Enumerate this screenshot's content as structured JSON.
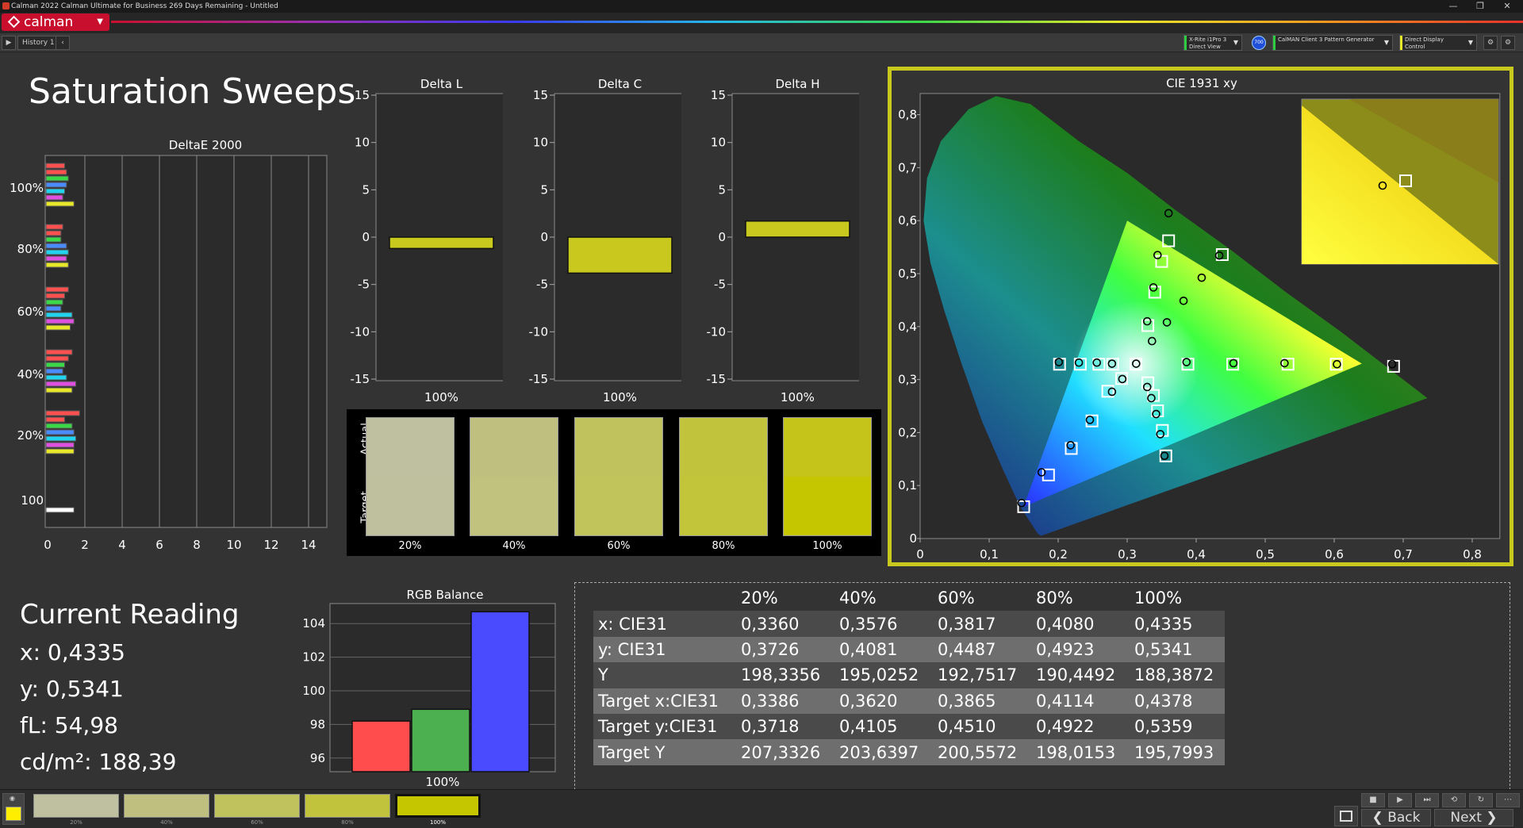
{
  "window": {
    "title": "Calman 2022 Calman Ultimate for Business 269 Days Remaining  - Untitled",
    "logo": "calman",
    "minimize": "—",
    "restore": "❐",
    "close": "✕"
  },
  "toolbar": {
    "history_tab": "History 1",
    "devices": [
      {
        "line1": "X-Rite i1Pro 3",
        "line2": "Direct View",
        "accent": "#2ecc40"
      },
      {
        "line1": "CalMAN Client 3 Pattern Generator",
        "line2": "",
        "accent": "#2ecc40"
      },
      {
        "line1": "Direct Display Control",
        "line2": "",
        "accent": "#e8e82a"
      }
    ],
    "badge": "700"
  },
  "page": {
    "title": "Saturation Sweeps"
  },
  "deltae_chart": {
    "title": "DeltaE 2000",
    "x_ticks": [
      "0",
      "2",
      "4",
      "6",
      "8",
      "10",
      "12",
      "14"
    ],
    "y_labels": [
      "100%",
      "80%",
      "60%",
      "40%",
      "20%",
      "100"
    ],
    "xlim": [
      0,
      15
    ],
    "groups": [
      {
        "label": "100%",
        "values": [
          1.0,
          1.1,
          1.2,
          1.1,
          1.0,
          0.9,
          1.5
        ]
      },
      {
        "label": "80%",
        "values": [
          0.9,
          0.8,
          0.8,
          1.1,
          1.2,
          1.1,
          1.2
        ]
      },
      {
        "label": "60%",
        "values": [
          1.2,
          1.0,
          0.9,
          0.8,
          1.4,
          1.5,
          1.3
        ]
      },
      {
        "label": "40%",
        "values": [
          1.4,
          1.2,
          1.0,
          0.9,
          1.1,
          1.6,
          1.4
        ]
      },
      {
        "label": "20%",
        "values": [
          1.8,
          1.0,
          1.4,
          1.5,
          1.6,
          1.5,
          1.5
        ]
      },
      {
        "label": "100",
        "values": [
          1.5
        ]
      }
    ],
    "series_colors": [
      "#ff5050",
      "#ff5050",
      "#3bd84a",
      "#4a8cff",
      "#22d3ee",
      "#e050e0",
      "#e8e82a"
    ]
  },
  "delta_charts": [
    {
      "title": "Delta L",
      "category": "100%",
      "value": -1.2
    },
    {
      "title": "Delta C",
      "category": "100%",
      "value": -3.8
    },
    {
      "title": "Delta H",
      "category": "100%",
      "value": 1.7
    }
  ],
  "delta_ticks": [
    "15",
    "10",
    "5",
    "0",
    "-5",
    "-10",
    "-15"
  ],
  "swatches": {
    "actual_label": "Actual",
    "target_label": "Target",
    "items": [
      {
        "label": "20%",
        "actual": "#bfc0a0",
        "target": "#bfc19e"
      },
      {
        "label": "40%",
        "actual": "#bfc07f",
        "target": "#c0c27d"
      },
      {
        "label": "60%",
        "actual": "#c0c25e",
        "target": "#c1c35b"
      },
      {
        "label": "80%",
        "actual": "#c2c33c",
        "target": "#c2c439"
      },
      {
        "label": "100%",
        "actual": "#c4c41a",
        "target": "#c5c500"
      }
    ]
  },
  "cie": {
    "title": "CIE 1931 xy",
    "x_ticks": [
      "0",
      "0,1",
      "0,2",
      "0,3",
      "0,4",
      "0,5",
      "0,6",
      "0,7",
      "0,8"
    ],
    "y_ticks": [
      "0",
      "0,1",
      "0,2",
      "0,3",
      "0,4",
      "0,5",
      "0,6",
      "0,7",
      "0,8"
    ],
    "gamut": [
      [
        0.64,
        0.33
      ],
      [
        0.3,
        0.6
      ],
      [
        0.15,
        0.06
      ]
    ],
    "white": [
      0.3127,
      0.329
    ],
    "targets": [
      [
        0.202,
        0.329
      ],
      [
        0.232,
        0.329
      ],
      [
        0.259,
        0.329
      ],
      [
        0.279,
        0.329
      ],
      [
        0.3127,
        0.329
      ],
      [
        0.388,
        0.329
      ],
      [
        0.453,
        0.329
      ],
      [
        0.533,
        0.329
      ],
      [
        0.603,
        0.329
      ],
      [
        0.686,
        0.325
      ],
      [
        0.33,
        0.402
      ],
      [
        0.34,
        0.465
      ],
      [
        0.35,
        0.523
      ],
      [
        0.36,
        0.562
      ],
      [
        0.4378,
        0.5359
      ],
      [
        0.292,
        0.302
      ],
      [
        0.272,
        0.278
      ],
      [
        0.249,
        0.222
      ],
      [
        0.219,
        0.17
      ],
      [
        0.186,
        0.12
      ],
      [
        0.15,
        0.06
      ],
      [
        0.33,
        0.294
      ],
      [
        0.338,
        0.27
      ],
      [
        0.344,
        0.241
      ],
      [
        0.351,
        0.204
      ],
      [
        0.356,
        0.156
      ]
    ],
    "actuals": [
      [
        0.201,
        0.333
      ],
      [
        0.23,
        0.332
      ],
      [
        0.256,
        0.332
      ],
      [
        0.278,
        0.33
      ],
      [
        0.313,
        0.33
      ],
      [
        0.386,
        0.333
      ],
      [
        0.454,
        0.331
      ],
      [
        0.528,
        0.331
      ],
      [
        0.604,
        0.329
      ],
      [
        0.684,
        0.329
      ],
      [
        0.329,
        0.41
      ],
      [
        0.338,
        0.474
      ],
      [
        0.344,
        0.535
      ],
      [
        0.36,
        0.614
      ],
      [
        0.4335,
        0.5341
      ],
      [
        0.293,
        0.301
      ],
      [
        0.278,
        0.277
      ],
      [
        0.246,
        0.224
      ],
      [
        0.218,
        0.176
      ],
      [
        0.176,
        0.125
      ],
      [
        0.147,
        0.067
      ],
      [
        0.329,
        0.286
      ],
      [
        0.335,
        0.265
      ],
      [
        0.342,
        0.235
      ],
      [
        0.348,
        0.197
      ],
      [
        0.354,
        0.156
      ],
      [
        0.336,
        0.3726
      ],
      [
        0.3576,
        0.4081
      ],
      [
        0.3817,
        0.4487
      ],
      [
        0.408,
        0.4923
      ]
    ]
  },
  "reading": {
    "title": "Current Reading",
    "x": "x: 0,4335",
    "y": "y: 0,5341",
    "fl": "fL: 54,98",
    "cdm2": "cd/m²: 188,39"
  },
  "rgb_balance": {
    "title": "RGB Balance",
    "category": "100%",
    "y_ticks": [
      "104",
      "102",
      "100",
      "98",
      "96"
    ],
    "ylim": [
      95,
      105
    ],
    "values": {
      "red": 98.2,
      "green": 98.9,
      "blue": 104.7
    },
    "colors": {
      "red": "#ff4d4d",
      "green": "#4caf50",
      "blue": "#4a4aff"
    }
  },
  "table": {
    "headers": [
      "",
      "20%",
      "40%",
      "60%",
      "80%",
      "100%"
    ],
    "rows": [
      [
        "x: CIE31",
        "0,3360",
        "0,3576",
        "0,3817",
        "0,4080",
        "0,4335"
      ],
      [
        "y: CIE31",
        "0,3726",
        "0,4081",
        "0,4487",
        "0,4923",
        "0,5341"
      ],
      [
        "Y",
        "198,3356",
        "195,0252",
        "192,7517",
        "190,4492",
        "188,3872"
      ],
      [
        "Target x:CIE31",
        "0,3386",
        "0,3620",
        "0,3865",
        "0,4114",
        "0,4378"
      ],
      [
        "Target y:CIE31",
        "0,3718",
        "0,4105",
        "0,4510",
        "0,4922",
        "0,5359"
      ],
      [
        "Target Y",
        "207,3326",
        "203,6397",
        "200,5572",
        "198,0153",
        "195,7993"
      ]
    ]
  },
  "bottom": {
    "swatches": [
      {
        "label": "20%",
        "color": "#bfc0a0"
      },
      {
        "label": "40%",
        "color": "#bfc07f"
      },
      {
        "label": "60%",
        "color": "#c0c25e"
      },
      {
        "label": "80%",
        "color": "#c2c33c"
      },
      {
        "label": "100%",
        "color": "#c5c500"
      }
    ],
    "back_label": "Back",
    "next_label": "Next"
  }
}
